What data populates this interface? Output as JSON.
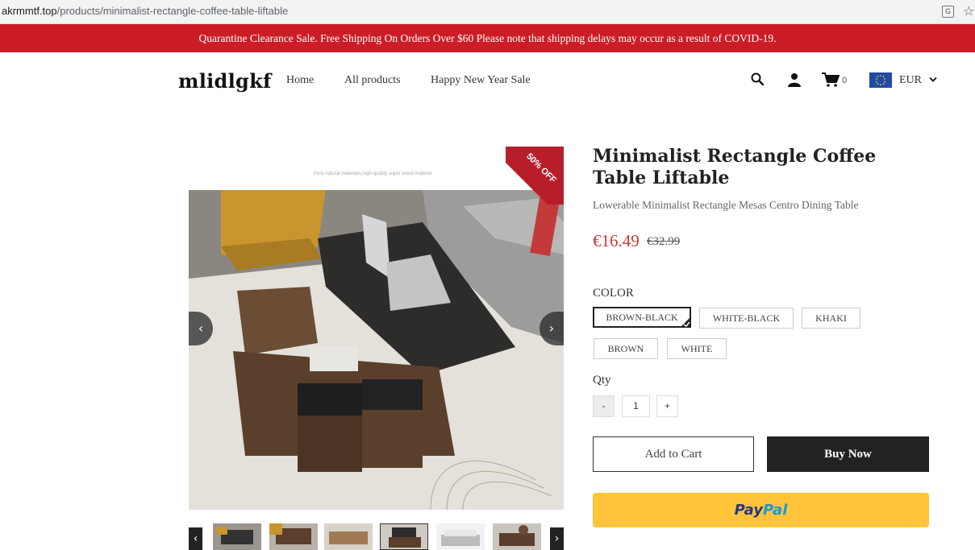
{
  "browser": {
    "url_domain": "akrmmtf.top",
    "url_path": "/products/minimalist-rectangle-coffee-table-liftable"
  },
  "announcement": "Quarantine Clearance Sale. Free Shipping On Orders Over $60 Please note that shipping delays may occur as a result of COVID-19.",
  "header": {
    "logo": "mlidlgkf",
    "nav": [
      "Home",
      "All products",
      "Happy New Year Sale"
    ],
    "cart_count": "0",
    "currency": "EUR"
  },
  "gallery": {
    "caption": "Pure natural materials,high-quality super wood material",
    "badge": "50% OFF",
    "prev": "‹",
    "next": "›",
    "thumb_count": 6,
    "active_thumb": 4
  },
  "product": {
    "title": "Minimalist Rectangle Coffee Table Liftable",
    "subtitle": "Lowerable Minimalist Rectangle Mesas Centro Dining Table",
    "price": "€16.49",
    "compare_price": "€32.99",
    "color_label": "COLOR",
    "colors": [
      "BROWN-BLACK",
      "WHITE-BLACK",
      "KHAKI",
      "BROWN",
      "WHITE"
    ],
    "selected_color": "BROWN-BLACK",
    "qty_label": "Qty",
    "qty_value": "1",
    "minus": "-",
    "plus": "+",
    "add_to_cart": "Add to Cart",
    "buy_now": "Buy Now",
    "paypal_1": "Pay",
    "paypal_2": "Pal"
  },
  "colors": {
    "announcement_bg": "#cc1d26",
    "price": "#c53a3a",
    "buy_now_bg": "#222222",
    "paypal_bg": "#ffc439"
  }
}
